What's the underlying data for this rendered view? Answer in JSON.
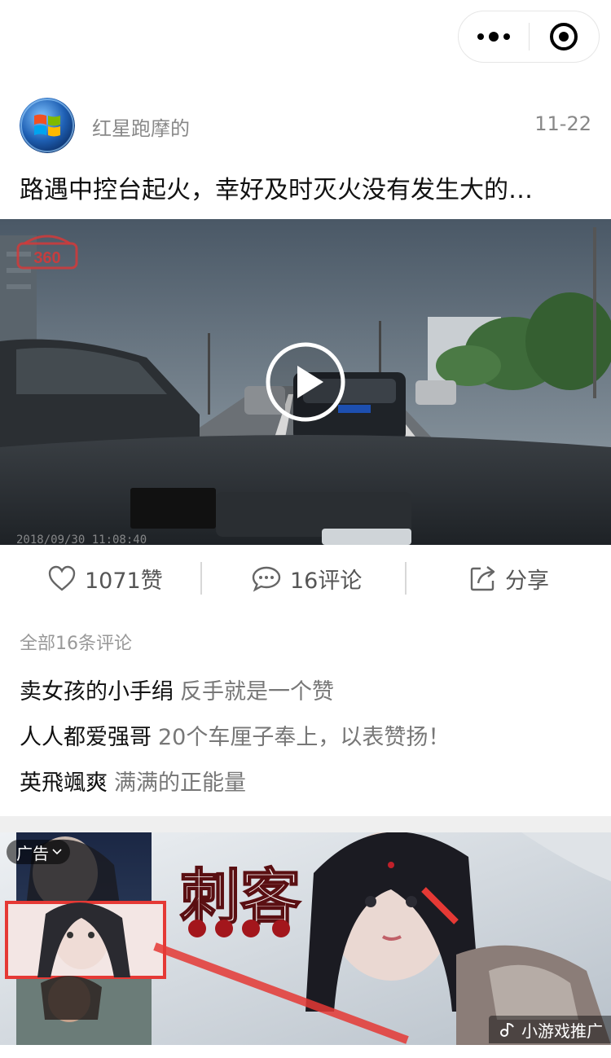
{
  "capsule": {
    "more_icon": "more-dots-icon",
    "close_icon": "target-circle-icon"
  },
  "post": {
    "author": "红星跑摩的",
    "date": "11-22",
    "title": "路遇中控台起火，幸好及时灭火没有发生大的…",
    "avatar_icon": "windows-logo-icon"
  },
  "video": {
    "watermark": "360",
    "timestamp": "2018/09/30  11:08:40",
    "play_icon": "play-icon"
  },
  "actions": {
    "like": "1071赞",
    "comment": "16评论",
    "share": "分享"
  },
  "comments": {
    "count_label": "全部16条评论",
    "items": [
      {
        "user": "卖女孩的小手绢",
        "text": "反手就是一个赞"
      },
      {
        "user": "人人都爱强哥",
        "text": "20个车厘子奉上，以表赞扬！"
      },
      {
        "user": "英飛颯爽",
        "text": "满满的正能量"
      }
    ]
  },
  "ad": {
    "label": "广告",
    "title_art": "刺客",
    "badge": "小游戏推广"
  },
  "colors": {
    "text_gray": "#888888",
    "ad_red": "#e53935"
  }
}
